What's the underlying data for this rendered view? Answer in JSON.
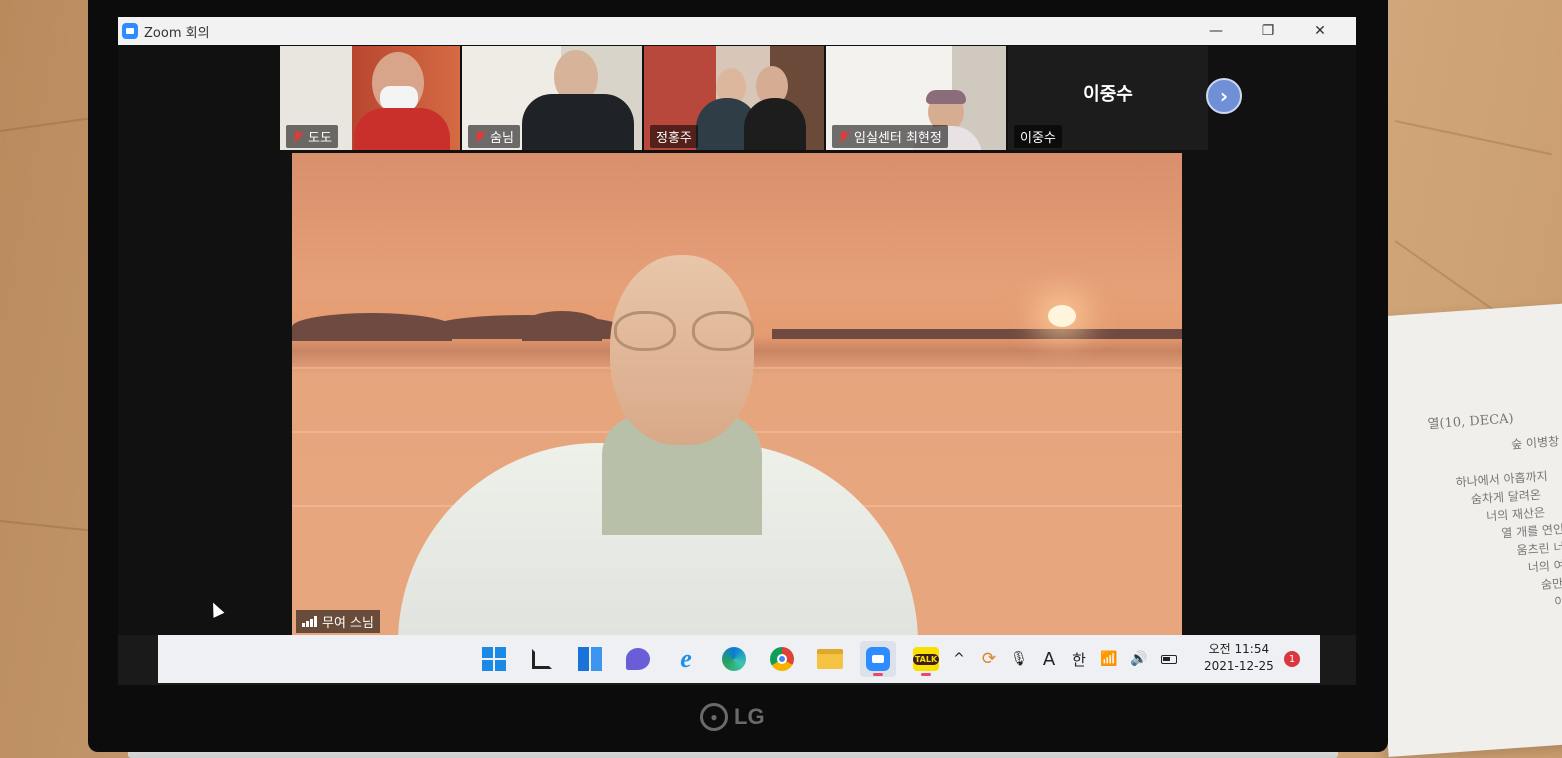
{
  "window": {
    "title": "Zoom 회의"
  },
  "participants": [
    {
      "name": "도도",
      "muted": true
    },
    {
      "name": "숨님",
      "muted": true
    },
    {
      "name": "정홍주",
      "muted": false
    },
    {
      "name": "임실센터 최현정",
      "muted": true
    },
    {
      "name": "이중수",
      "muted": false,
      "video": false
    }
  ],
  "name_tile": {
    "display_name": "이중수"
  },
  "main_speaker": {
    "name": "무여 스님"
  },
  "clock": {
    "time": "오전 11:54",
    "date": "2021-12-25"
  },
  "tray": {
    "input_mode": "A",
    "ime": "한"
  },
  "notifications": {
    "count": "1"
  },
  "taskbar_icons": [
    "windows-start",
    "search",
    "widgets",
    "teams-chat",
    "internet-explorer",
    "edge",
    "chrome",
    "file-explorer",
    "zoom",
    "kakaotalk"
  ],
  "laptop": {
    "brand": "LG"
  },
  "paper": {
    "lines": [
      "열(10, DECA)",
      "숲 이병창",
      "하나에서 아홉까지",
      "숨차게 달려온",
      "너의 재산은",
      "열 개를 연인",
      "움츠린 너",
      "너의 여",
      "숨만",
      "이"
    ]
  },
  "colors": {
    "zoom_blue": "#2d8cff",
    "muted_red": "#e03a3a",
    "badge_red": "#d9363e"
  }
}
